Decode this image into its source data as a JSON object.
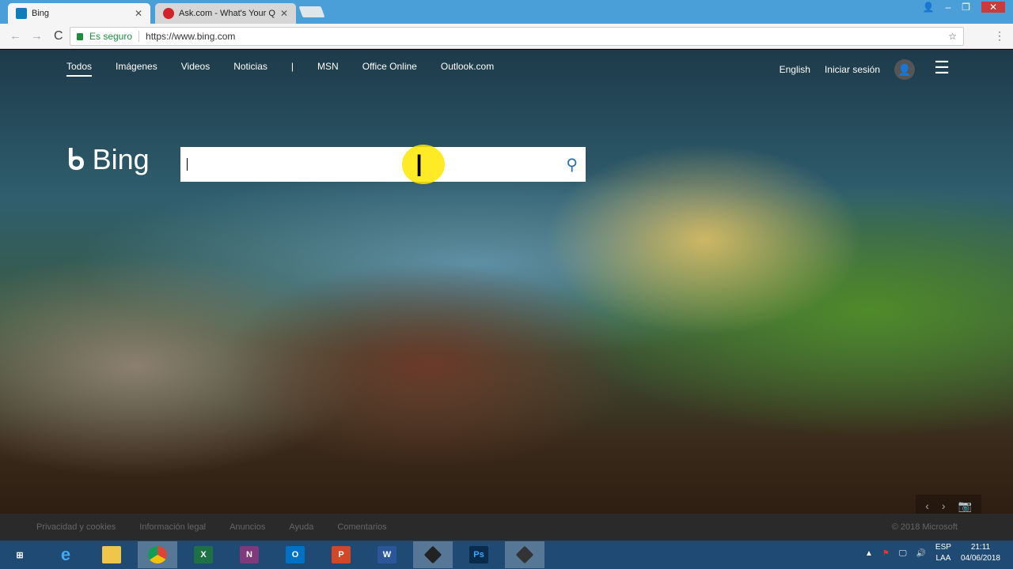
{
  "browser": {
    "tabs": [
      {
        "label": "Bing",
        "active": true
      },
      {
        "label": "Ask.com - What's Your Q"
      }
    ],
    "secure_label": "Es seguro",
    "url": "https://www.bing.com"
  },
  "bing": {
    "nav": [
      "Todos",
      "Imágenes",
      "Videos",
      "Noticias",
      "|",
      "MSN",
      "Office Online",
      "Outlook.com"
    ],
    "language": "English",
    "sign_in": "Iniciar sesión",
    "logo": "Bing",
    "search_value": ""
  },
  "footer": {
    "links": [
      "Privacidad y cookies",
      "Información legal",
      "Anuncios",
      "Ayuda",
      "Comentarios"
    ],
    "copyright": "© 2018 Microsoft"
  },
  "taskbar": {
    "apps": [
      "Internet Explorer",
      "File Explorer",
      "Chrome",
      "Excel",
      "OneNote",
      "Outlook",
      "PowerPoint",
      "Word",
      "App",
      "Photoshop",
      "App2"
    ],
    "lang1": "ESP",
    "lang2": "LAA",
    "time": "21:11",
    "date": "04/06/2018"
  }
}
